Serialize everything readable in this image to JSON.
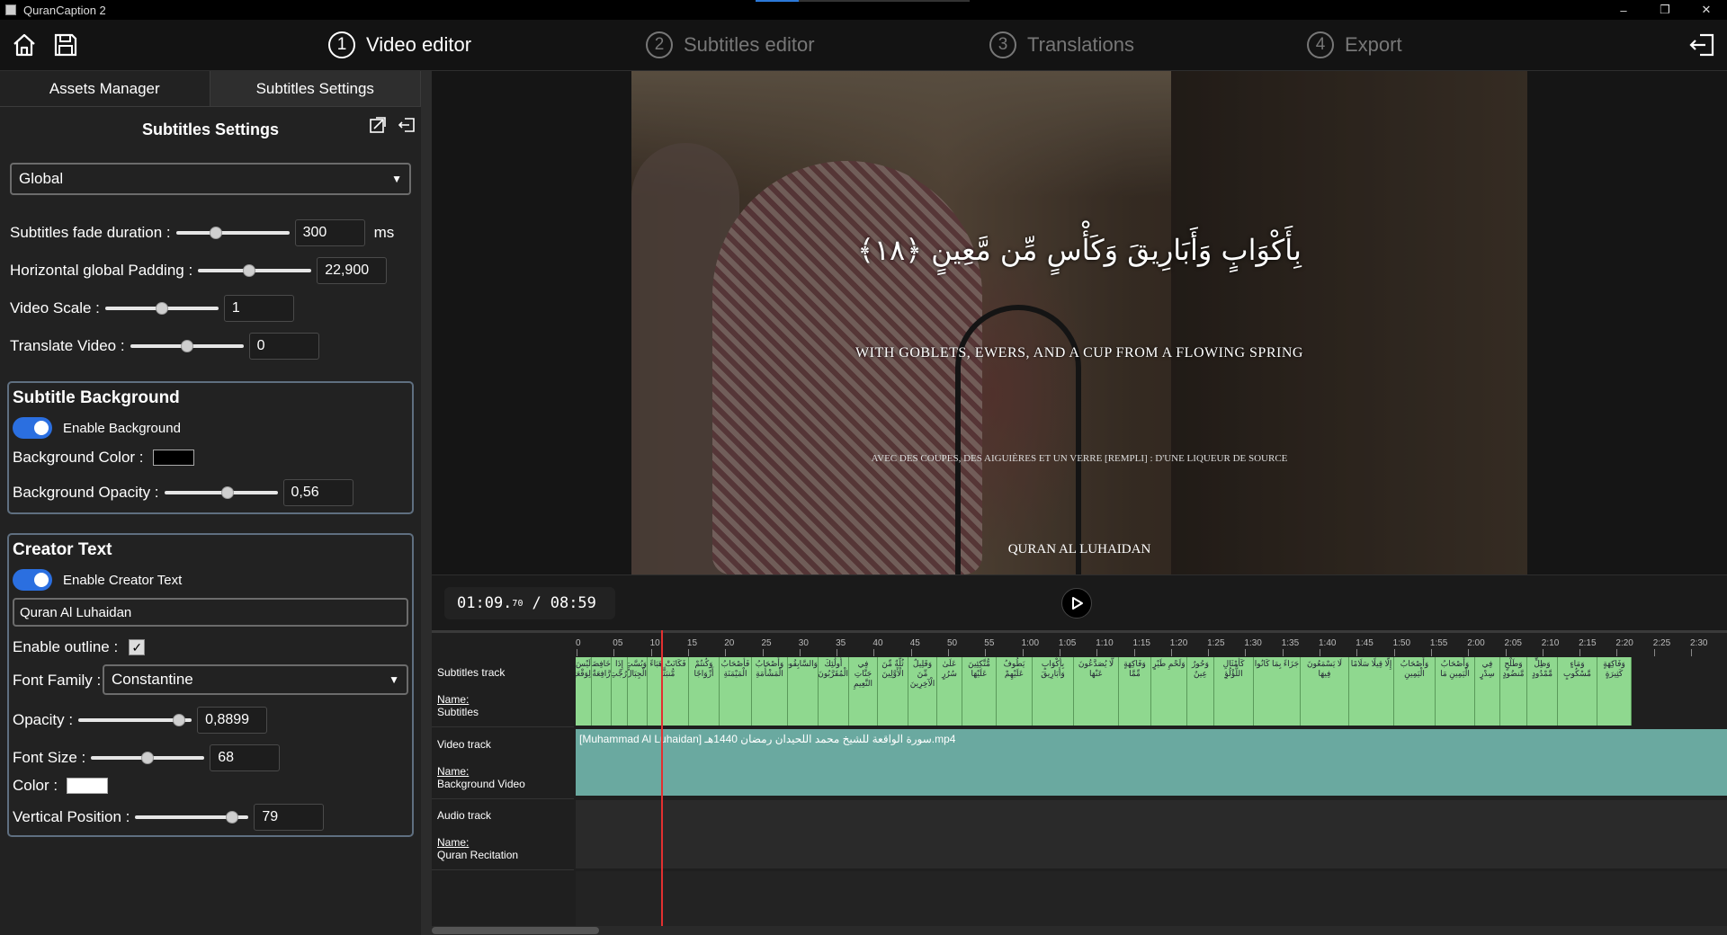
{
  "window": {
    "title": "QuranCaption 2",
    "controls": [
      "–",
      "❐",
      "✕"
    ]
  },
  "header": {
    "home_icon": "home-icon",
    "save_icon": "save-icon",
    "exit_icon": "exit-icon",
    "steps": [
      {
        "num": "1",
        "label": "Video editor",
        "active": true
      },
      {
        "num": "2",
        "label": "Subtitles editor",
        "active": false
      },
      {
        "num": "3",
        "label": "Translations",
        "active": false
      },
      {
        "num": "4",
        "label": "Export",
        "active": false
      }
    ]
  },
  "left_panel": {
    "tabs": [
      "Assets Manager",
      "Subtitles Settings"
    ],
    "title": "Subtitles Settings",
    "scope_select": "Global",
    "settings": {
      "fade": {
        "label": "Subtitles fade duration :",
        "value": "300",
        "unit": "ms",
        "level": 0.35
      },
      "padding": {
        "label": "Horizontal global Padding :",
        "value": "22,900",
        "level": 0.45
      },
      "scale": {
        "label": "Video Scale :",
        "value": "1",
        "level": 0.5
      },
      "translate": {
        "label": "Translate Video :",
        "value": "0",
        "level": 0.5
      }
    },
    "background": {
      "title": "Subtitle Background",
      "enable_label": "Enable Background",
      "color_label": "Background Color :",
      "color": "#000000",
      "opacity_label": "Background Opacity :",
      "opacity_value": "0,56",
      "opacity_level": 0.56
    },
    "creator": {
      "title": "Creator Text",
      "enable_label": "Enable Creator Text",
      "text": "Quran Al Luhaidan",
      "outline_label": "Enable outline :",
      "font_label": "Font Family :",
      "font_value": "Constantine",
      "opacity_label": "Opacity :",
      "opacity_value": "0,8899",
      "opacity_level": 0.89,
      "size_label": "Font Size :",
      "size_value": "68",
      "size_level": 0.5,
      "color_label": "Color :",
      "color": "#ffffff",
      "vpos_label": "Vertical Position :",
      "vpos_value": "79",
      "vpos_level": 0.85
    }
  },
  "video": {
    "arabic": "بِأَكْوَابٍ وَأَبَارِيقَ وَكَأْسٍ مِّن مَّعِينٍ ﴿١٨﴾",
    "english": "WITH GOBLETS, EWERS, AND A CUP FROM A FLOWING SPRING",
    "french": "AVEC DES COUPES, DES AIGUIÈRES ET UN VERRE [REMPLI] : D'UNE LIQUEUR DE SOURCE",
    "creator": "QURAN AL LUHAIDAN"
  },
  "player": {
    "current": "01:09.",
    "current_ms": "70",
    "separator": "/",
    "total": "08:59",
    "play_icon": "play-icon"
  },
  "timeline": {
    "ticks": [
      "0",
      "05",
      "10",
      "15",
      "20",
      "25",
      "30",
      "35",
      "40",
      "45",
      "50",
      "55",
      "1:00",
      "1:05",
      "1:10",
      "1:15",
      "1:20",
      "1:25",
      "1:30",
      "1:35",
      "1:40",
      "1:45",
      "1:50",
      "1:55",
      "2:00",
      "2:05",
      "2:10",
      "2:15",
      "2:20",
      "2:25",
      "2:30"
    ],
    "tracks": [
      {
        "type": "Subtitles track",
        "name_label": "Name:",
        "name": "Subtitles"
      },
      {
        "type": "Video track",
        "name_label": "Name:",
        "name": "Background Video"
      },
      {
        "type": "Audio track",
        "name_label": "Name:",
        "name": "Quran Recitation"
      }
    ],
    "video_clip": "[Muhammad Al Luhaidan] سورة الواقعة للشيخ محمد اللحيدان رمضان 1440هـ.mp4",
    "subtitle_segments": [
      {
        "w": 18,
        "t": "لَيْسَ لِوَقْعَتِهَا"
      },
      {
        "w": 22,
        "t": "خَافِضَةٌ رَّافِعَةٌ"
      },
      {
        "w": 18,
        "t": "إِذَا رُجَّتِ"
      },
      {
        "w": 22,
        "t": "وَبُسَّتِ الْجِبَالُ"
      },
      {
        "w": 46,
        "t": "فَكَانَتْ هَبَاءً مُّنبَثًّا"
      },
      {
        "w": 34,
        "t": "وَكُنتُمْ أَزْوَاجًا"
      },
      {
        "w": 36,
        "t": "فَأَصْحَابُ الْمَيْمَنَةِ"
      },
      {
        "w": 40,
        "t": "وَأَصْحَابُ الْمَشْأَمَةِ"
      },
      {
        "w": 34,
        "t": "وَالسَّابِقُونَ"
      },
      {
        "w": 34,
        "t": "أُولَٰئِكَ الْمُقَرَّبُونَ"
      },
      {
        "w": 32,
        "t": "فِي جَنَّاتِ النَّعِيمِ"
      },
      {
        "w": 34,
        "t": "ثُلَّةٌ مِّنَ الْأَوَّلِينَ"
      },
      {
        "w": 32,
        "t": "وَقَلِيلٌ مِّنَ الْآخِرِينَ"
      },
      {
        "w": 28,
        "t": "عَلَىٰ سُرُرٍ"
      },
      {
        "w": 38,
        "t": "مُّتَّكِئِينَ عَلَيْهَا"
      },
      {
        "w": 40,
        "t": "يَطُوفُ عَلَيْهِمْ"
      },
      {
        "w": 46,
        "t": "بِأَكْوَابٍ وَأَبَارِيقَ"
      },
      {
        "w": 50,
        "t": "لَّا يُصَدَّعُونَ عَنْهَا"
      },
      {
        "w": 36,
        "t": "وَفَاكِهَةٍ مِّمَّا"
      },
      {
        "w": 40,
        "t": "وَلَحْمِ طَيْرٍ"
      },
      {
        "w": 30,
        "t": "وَحُورٌ عِينٌ"
      },
      {
        "w": 44,
        "t": "كَأَمْثَالِ اللُّؤْلُؤِ"
      },
      {
        "w": 52,
        "t": "جَزَاءً بِمَا كَانُوا"
      },
      {
        "w": 54,
        "t": "لَا يَسْمَعُونَ فِيهَا"
      },
      {
        "w": 50,
        "t": "إِلَّا قِيلًا سَلَامًا"
      },
      {
        "w": 46,
        "t": "وَأَصْحَابُ الْيَمِينِ"
      },
      {
        "w": 44,
        "t": "وَأَصْحَابُ الْيَمِينِ مَا"
      },
      {
        "w": 28,
        "t": "فِي سِدْرٍ"
      },
      {
        "w": 30,
        "t": "وَطَلْحٍ مَّنضُودٍ"
      },
      {
        "w": 34,
        "t": "وَظِلٍّ مَّمْدُودٍ"
      },
      {
        "w": 44,
        "t": "وَمَاءٍ مَّسْكُوبٍ"
      },
      {
        "w": 38,
        "t": "وَفَاكِهَةٍ كَثِيرَةٍ"
      }
    ]
  }
}
